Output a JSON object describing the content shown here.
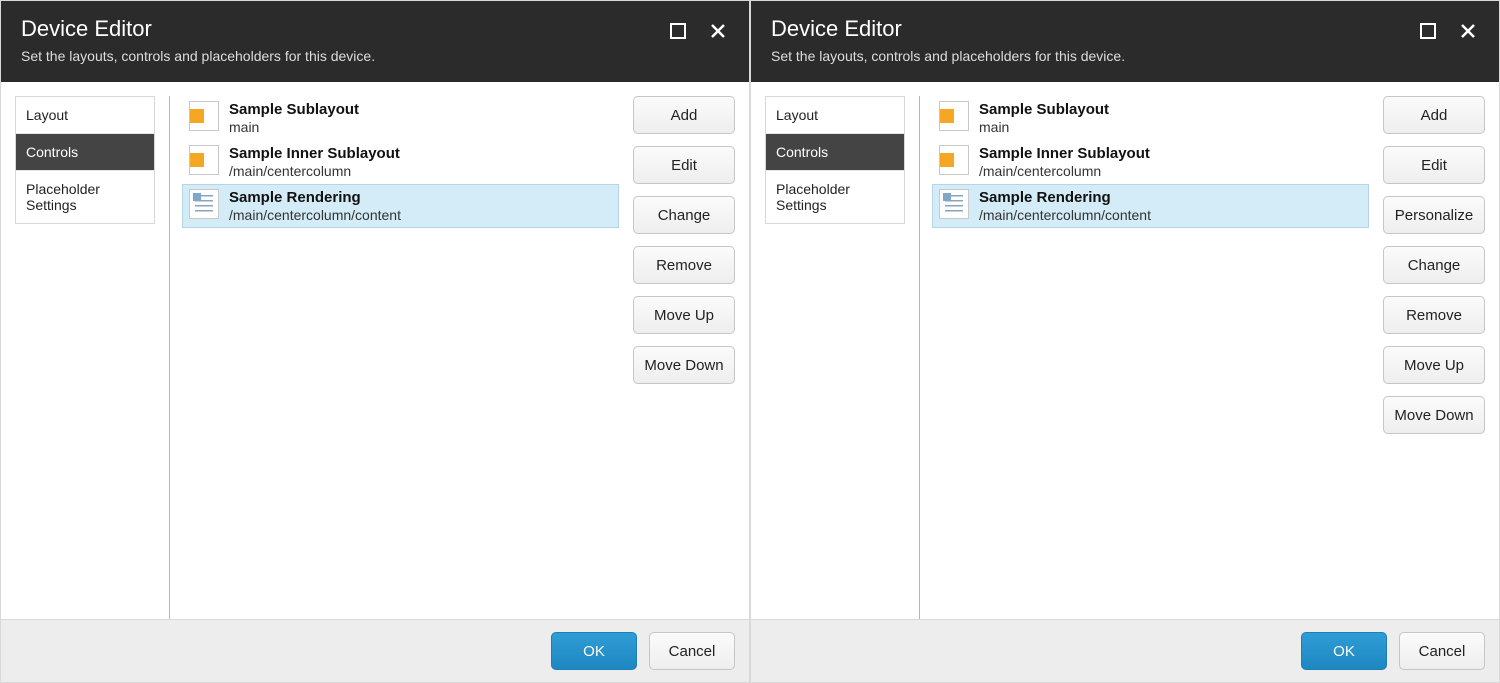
{
  "labels": {
    "add": "Add",
    "edit": "Edit",
    "personalize": "Personalize",
    "change": "Change",
    "remove": "Remove",
    "moveup": "Move Up",
    "movedown": "Move Down",
    "ok": "OK",
    "cancel": "Cancel"
  },
  "panels": [
    {
      "title": "Device Editor",
      "subtitle": "Set the layouts, controls and placeholders for this device.",
      "sidebar": [
        {
          "label": "Layout",
          "active": false
        },
        {
          "label": "Controls",
          "active": true
        },
        {
          "label": "Placeholder Settings",
          "active": false
        }
      ],
      "items": [
        {
          "title": "Sample Sublayout",
          "sub": "main",
          "icon": "sublayout",
          "selected": false
        },
        {
          "title": "Sample Inner Sublayout",
          "sub": "/main/centercolumn",
          "icon": "sublayout",
          "selected": false
        },
        {
          "title": "Sample Rendering",
          "sub": "/main/centercolumn/content",
          "icon": "rendering",
          "selected": true
        }
      ],
      "actions": [
        [
          "add",
          "edit",
          "change",
          "remove"
        ],
        [
          "moveup",
          "movedown"
        ]
      ]
    },
    {
      "title": "Device Editor",
      "subtitle": "Set the layouts, controls and placeholders for this device.",
      "sidebar": [
        {
          "label": "Layout",
          "active": false
        },
        {
          "label": "Controls",
          "active": true
        },
        {
          "label": "Placeholder Settings",
          "active": false
        }
      ],
      "items": [
        {
          "title": "Sample Sublayout",
          "sub": "main",
          "icon": "sublayout",
          "selected": false
        },
        {
          "title": "Sample Inner Sublayout",
          "sub": "/main/centercolumn",
          "icon": "sublayout",
          "selected": false
        },
        {
          "title": "Sample Rendering",
          "sub": "/main/centercolumn/content",
          "icon": "rendering",
          "selected": true
        }
      ],
      "actions": [
        [
          "add",
          "edit",
          "personalize",
          "change",
          "remove"
        ],
        [
          "moveup",
          "movedown"
        ]
      ]
    }
  ]
}
